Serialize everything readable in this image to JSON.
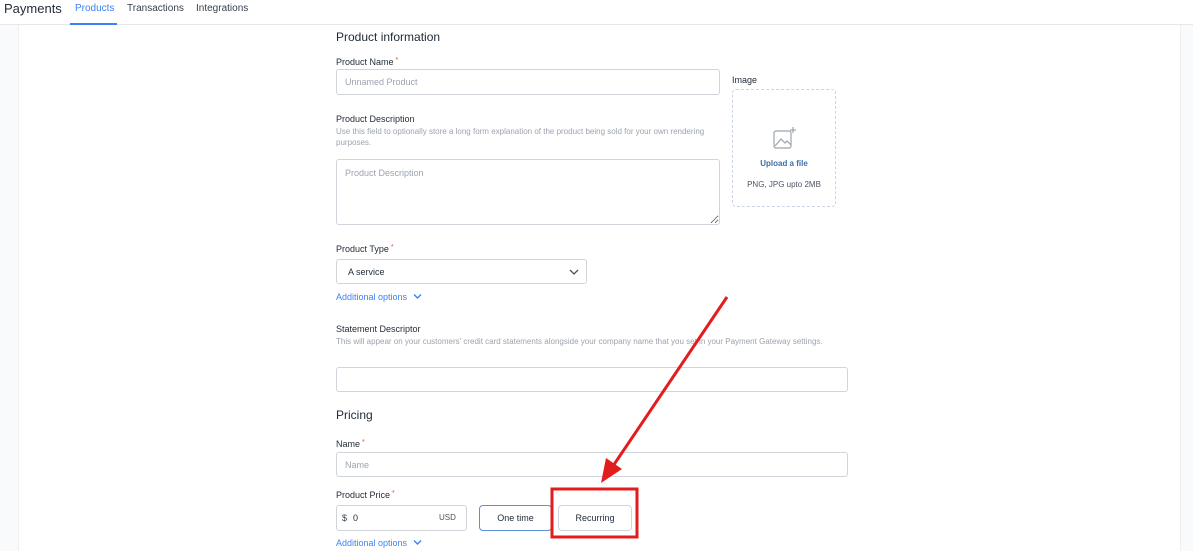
{
  "header": {
    "title": "Payments",
    "tabs": [
      {
        "label": "Products",
        "active": true
      },
      {
        "label": "Transactions",
        "active": false
      },
      {
        "label": "Integrations",
        "active": false
      }
    ]
  },
  "product_info": {
    "section_title": "Product information",
    "name": {
      "label": "Product Name",
      "required": "*",
      "placeholder": "Unnamed Product",
      "value": ""
    },
    "description": {
      "label": "Product Description",
      "help": "Use this field to optionally store a long form explanation of the product being sold for your own rendering purposes.",
      "placeholder": "Product Description",
      "value": ""
    },
    "image": {
      "label": "Image",
      "upload_link": "Upload a file",
      "hint": "PNG, JPG upto 2MB",
      "icon": "image-add-icon"
    },
    "type": {
      "label": "Product Type",
      "required": "*",
      "selected": "A service"
    },
    "additional_options": "Additional options",
    "statement": {
      "label": "Statement Descriptor",
      "help": "This will appear on your customers' credit card statements alongside your company name that you set in your Payment Gateway settings.",
      "value": ""
    }
  },
  "pricing": {
    "section_title": "Pricing",
    "name": {
      "label": "Name",
      "required": "*",
      "placeholder": "Name",
      "value": ""
    },
    "price": {
      "label": "Product Price",
      "required": "*",
      "currency_symbol": "$",
      "value": "0",
      "currency": "USD"
    },
    "one_time_label": "One time",
    "recurring_label": "Recurring",
    "additional_options": "Additional options"
  },
  "annotation": {
    "color": "#e11d1d"
  },
  "colors": {
    "accent": "#3b82f6",
    "required": "#ef4444"
  }
}
